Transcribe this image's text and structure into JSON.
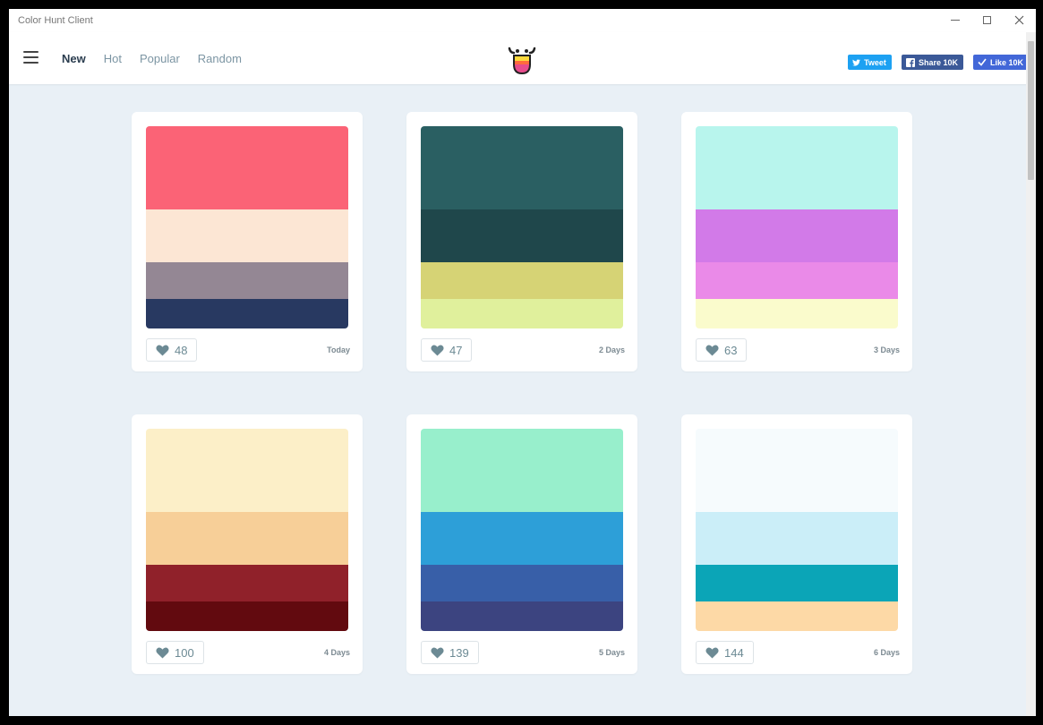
{
  "window": {
    "title": "Color Hunt Client"
  },
  "nav": {
    "links": [
      "New",
      "Hot",
      "Popular",
      "Random"
    ]
  },
  "social": {
    "tweet": "Tweet",
    "share": "Share 10K",
    "like": "Like 10K"
  },
  "palettes": [
    {
      "likes": "48",
      "date": "Today",
      "colors": [
        "#fb6376",
        "#fce6d4",
        "#948794",
        "#283961"
      ]
    },
    {
      "likes": "47",
      "date": "2 Days",
      "colors": [
        "#2a5f62",
        "#1f474b",
        "#d6d375",
        "#e0f09c"
      ]
    },
    {
      "likes": "63",
      "date": "3 Days",
      "colors": [
        "#b8f5ed",
        "#d27ae8",
        "#ea8ae8",
        "#fafbcc"
      ]
    },
    {
      "likes": "100",
      "date": "4 Days",
      "colors": [
        "#fcefc8",
        "#f7cf98",
        "#90212a",
        "#620a0f"
      ]
    },
    {
      "likes": "139",
      "date": "5 Days",
      "colors": [
        "#98efcc",
        "#2d9fd8",
        "#385fa8",
        "#3c4480"
      ]
    },
    {
      "likes": "144",
      "date": "6 Days",
      "colors": [
        "#f6fbfd",
        "#cbeef8",
        "#0ba5b7",
        "#fdd9a6"
      ]
    }
  ]
}
